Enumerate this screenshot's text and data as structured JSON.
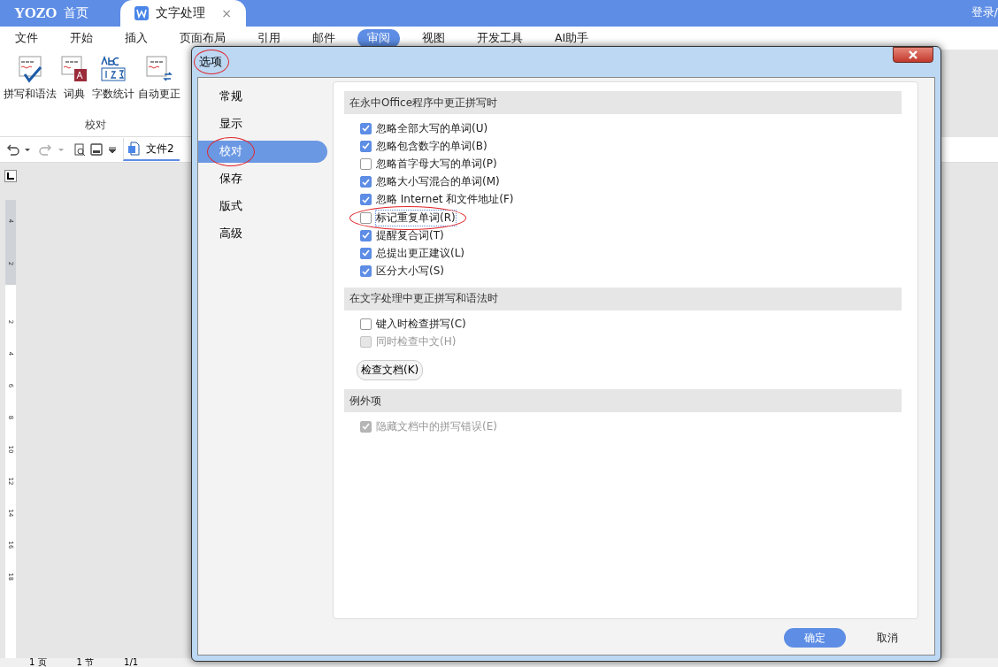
{
  "app_tabs": [
    {
      "label": "首页",
      "kind": "home",
      "logo": "YOZO",
      "selected": false
    },
    {
      "label": "文字处理",
      "kind": "doc",
      "close": "×",
      "selected": true
    }
  ],
  "account": {
    "label": "登录/"
  },
  "menu": [
    {
      "label": "文件",
      "selected": false
    },
    {
      "label": "开始",
      "selected": false
    },
    {
      "label": "插入",
      "selected": false
    },
    {
      "label": "页面布局",
      "selected": false
    },
    {
      "label": "引用",
      "selected": false
    },
    {
      "label": "邮件",
      "selected": false
    },
    {
      "label": "审阅",
      "selected": true
    },
    {
      "label": "视图",
      "selected": false
    },
    {
      "label": "开发工具",
      "selected": false
    },
    {
      "label": "AI助手",
      "selected": false
    }
  ],
  "ribbon": {
    "group": "校对",
    "buttons": [
      {
        "label": "拼写和语法",
        "kind": "spell"
      },
      {
        "label": "词典",
        "kind": "dict"
      },
      {
        "label": "字数统计",
        "kind": "count"
      },
      {
        "label": "自动更正",
        "kind": "autocorrect"
      }
    ]
  },
  "doc_tab": {
    "label": "文件2"
  },
  "ruler": {
    "marks": [
      "4",
      "2",
      "2",
      "4",
      "6",
      "8",
      "10",
      "12",
      "14",
      "16",
      "18"
    ]
  },
  "dialog": {
    "title": "选项",
    "title_circled": true,
    "nav": [
      {
        "label": "常规",
        "selected": false,
        "circled": false
      },
      {
        "label": "显示",
        "selected": false,
        "circled": false
      },
      {
        "label": "校对",
        "selected": true,
        "circled": true
      },
      {
        "label": "保存",
        "selected": false,
        "circled": false
      },
      {
        "label": "版式",
        "selected": false,
        "circled": false
      },
      {
        "label": "高级",
        "selected": false,
        "circled": false
      }
    ],
    "sections": [
      {
        "heading": "在永中Office程序中更正拼写时",
        "options": [
          {
            "label": "忽略全部大写的单词(U)",
            "checked": true,
            "disabled": false,
            "circled": false
          },
          {
            "label": "忽略包含数字的单词(B)",
            "checked": true,
            "disabled": false,
            "circled": false
          },
          {
            "label": "忽略首字母大写的单词(P)",
            "checked": false,
            "disabled": false,
            "circled": false
          },
          {
            "label": "忽略大小写混合的单词(M)",
            "checked": true,
            "disabled": false,
            "circled": false
          },
          {
            "label": "忽略 Internet 和文件地址(F)",
            "checked": true,
            "disabled": false,
            "circled": false
          },
          {
            "label": "标记重复单词(R)",
            "checked": false,
            "disabled": false,
            "circled": true
          },
          {
            "label": "提醒复合词(T)",
            "checked": true,
            "disabled": false,
            "circled": false
          },
          {
            "label": "总提出更正建议(L)",
            "checked": true,
            "disabled": false,
            "circled": false
          },
          {
            "label": "区分大小写(S)",
            "checked": true,
            "disabled": false,
            "circled": false
          }
        ]
      },
      {
        "heading": "在文字处理中更正拼写和语法时",
        "options": [
          {
            "label": "键入时检查拼写(C)",
            "checked": false,
            "disabled": false,
            "circled": false
          },
          {
            "label": "同时检查中文(H)",
            "checked": false,
            "disabled": true,
            "circled": false
          }
        ],
        "button": "检查文档(K)"
      },
      {
        "heading": "例外项",
        "options": [
          {
            "label": "隐藏文档中的拼写错误(E)",
            "checked": true,
            "disabled": true,
            "circled": false
          }
        ]
      }
    ],
    "ok": "确定",
    "cancel": "取消"
  },
  "status_bar": [
    "1 页",
    "1 节",
    "1/1"
  ]
}
